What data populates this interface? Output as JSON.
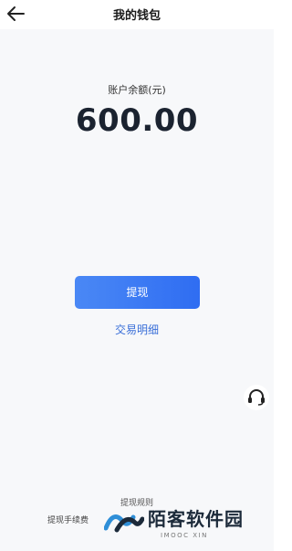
{
  "header": {
    "back_icon": "arrow-left-icon",
    "title": "我的钱包"
  },
  "balance": {
    "label": "账户余额(元)",
    "amount": "600.00"
  },
  "actions": {
    "withdraw_label": "提现",
    "transactions_label": "交易明细"
  },
  "support": {
    "icon": "headset-icon"
  },
  "rules": {
    "title": "提现规则",
    "fee_text": "提现手续费"
  },
  "watermark": {
    "main": "陌客软件园",
    "sub": "IMOOC XIN"
  },
  "colors": {
    "accent": "#3a78f2",
    "link": "#3a6fd8",
    "amount": "#1b2330",
    "background": "#f7f8fa"
  }
}
